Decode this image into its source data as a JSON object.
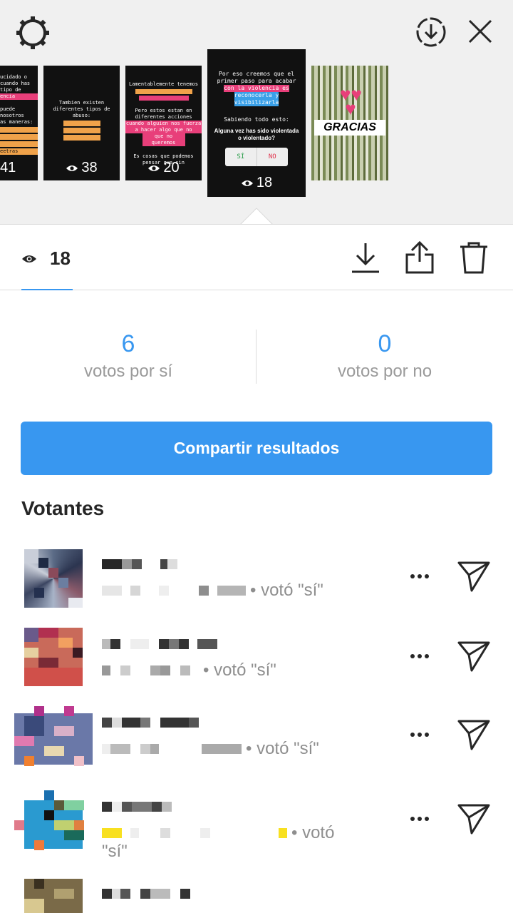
{
  "header": {
    "settings_icon": "gear-icon",
    "save_icon": "download-circle-icon",
    "close_icon": "close-icon"
  },
  "stories": [
    {
      "views": "41",
      "lines": [
        "ucidado o",
        "cuando has",
        "tipo de",
        "encia",
        "",
        "puede",
        "nosotros",
        "as maneras:",
        "",
        "",
        "",
        "eetras"
      ]
    },
    {
      "views": "38",
      "lines": [
        "Tambien existen",
        "diferentes tipos de",
        "abuso:"
      ]
    },
    {
      "views": "20",
      "lines": [
        "Lamentablemente tenemos",
        "Pero estos estan en",
        "diferentes acciones",
        "cuando alguien nos fuerza",
        "a hacer algo que no",
        "que no queremos",
        "Es cosas que podemos",
        "pensar que sin"
      ]
    },
    {
      "views": "18",
      "lines": [
        "Por eso creemos que el",
        "primer paso para acabar",
        "con la violencia es",
        "reconocerla y",
        "visibilizarla",
        "Sabiendo todo esto:",
        "Alguna vez has sido violentada",
        "o violentado?"
      ],
      "poll_yes": "SÍ",
      "poll_no": "NO"
    },
    {
      "views": "",
      "overlay": "GRACIAS"
    }
  ],
  "stats": {
    "views": "18",
    "eye_icon": "eye-icon",
    "download_icon": "download-icon",
    "share_icon": "share-icon",
    "trash_icon": "trash-icon"
  },
  "poll_results": {
    "yes_count": "6",
    "yes_label": "votos por sí",
    "no_count": "0",
    "no_label": "votos por no"
  },
  "share_button": "Compartir resultados",
  "voters_title": "Votantes",
  "voters": [
    {
      "vote": "• votó \"sí\""
    },
    {
      "vote": "• votó \"sí\""
    },
    {
      "vote": "• votó \"sí\""
    },
    {
      "vote": "• votó",
      "vote_cont": "\"sí\""
    }
  ],
  "colors": {
    "accent": "#3897f0",
    "muted_text": "#8e8e8e",
    "strip_background": "#f0f0f0"
  }
}
